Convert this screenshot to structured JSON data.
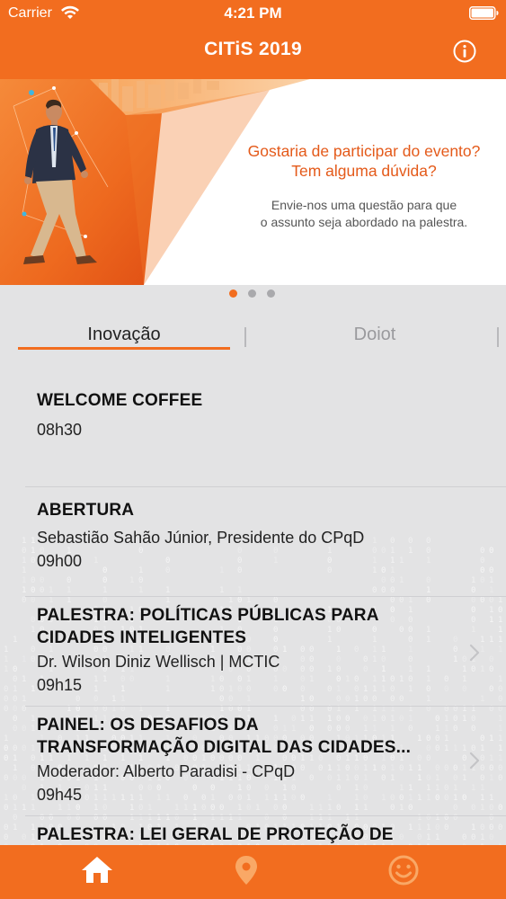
{
  "status_bar": {
    "carrier": "Carrier",
    "time": "4:21 PM"
  },
  "header": {
    "title": "CITiS 2019"
  },
  "icons": {
    "wifi": "wifi-icon",
    "battery": "battery-icon",
    "info": "info-icon",
    "chevron": "chevron-right-icon",
    "home": "home-icon",
    "location": "location-pin-icon",
    "smiley": "smiley-icon"
  },
  "banner": {
    "headline_line1": "Gostaria de participar do evento?",
    "headline_line2": "Tem alguma dúvida?",
    "body_line1": "Envie-nos uma questão para que",
    "body_line2": "o assunto seja abordado na palestra."
  },
  "pager": {
    "count": 3,
    "active_index": 0
  },
  "tabs": [
    {
      "label": "Inovação",
      "selected": true
    },
    {
      "label": "Doiot",
      "selected": false
    }
  ],
  "schedule": [
    {
      "title_line1": "WELCOME COFFEE",
      "title_line2": "",
      "speaker": "",
      "time": "08h30",
      "has_detail": false
    },
    {
      "title_line1": "ABERTURA",
      "title_line2": "",
      "speaker": "Sebastião Sahão Júnior, Presidente do CPqD",
      "time": "09h00",
      "has_detail": false
    },
    {
      "title_line1": "PALESTRA: POLÍTICAS PÚBLICAS PARA",
      "title_line2": "CIDADES INTELIGENTES",
      "speaker": "Dr. Wilson Diniz Wellisch | MCTIC",
      "time": "09h15",
      "has_detail": true
    },
    {
      "title_line1": "PAINEL: OS DESAFIOS DA",
      "title_line2": "TRANSFORMAÇÃO DIGITAL DAS CIDADES...",
      "speaker": "Moderador: Alberto Paradisi - CPqD",
      "time": "09h45",
      "has_detail": true
    },
    {
      "title_line1": "PALESTRA: LEI GERAL DE PROTEÇÃO DE",
      "title_line2": "",
      "speaker": "",
      "time": "",
      "has_detail": false
    }
  ],
  "colors": {
    "accent": "#f26d1f",
    "background": "#e3e3e4",
    "tab_inactive": "#9a9a9d",
    "dot_inactive": "#a9a9ac"
  }
}
